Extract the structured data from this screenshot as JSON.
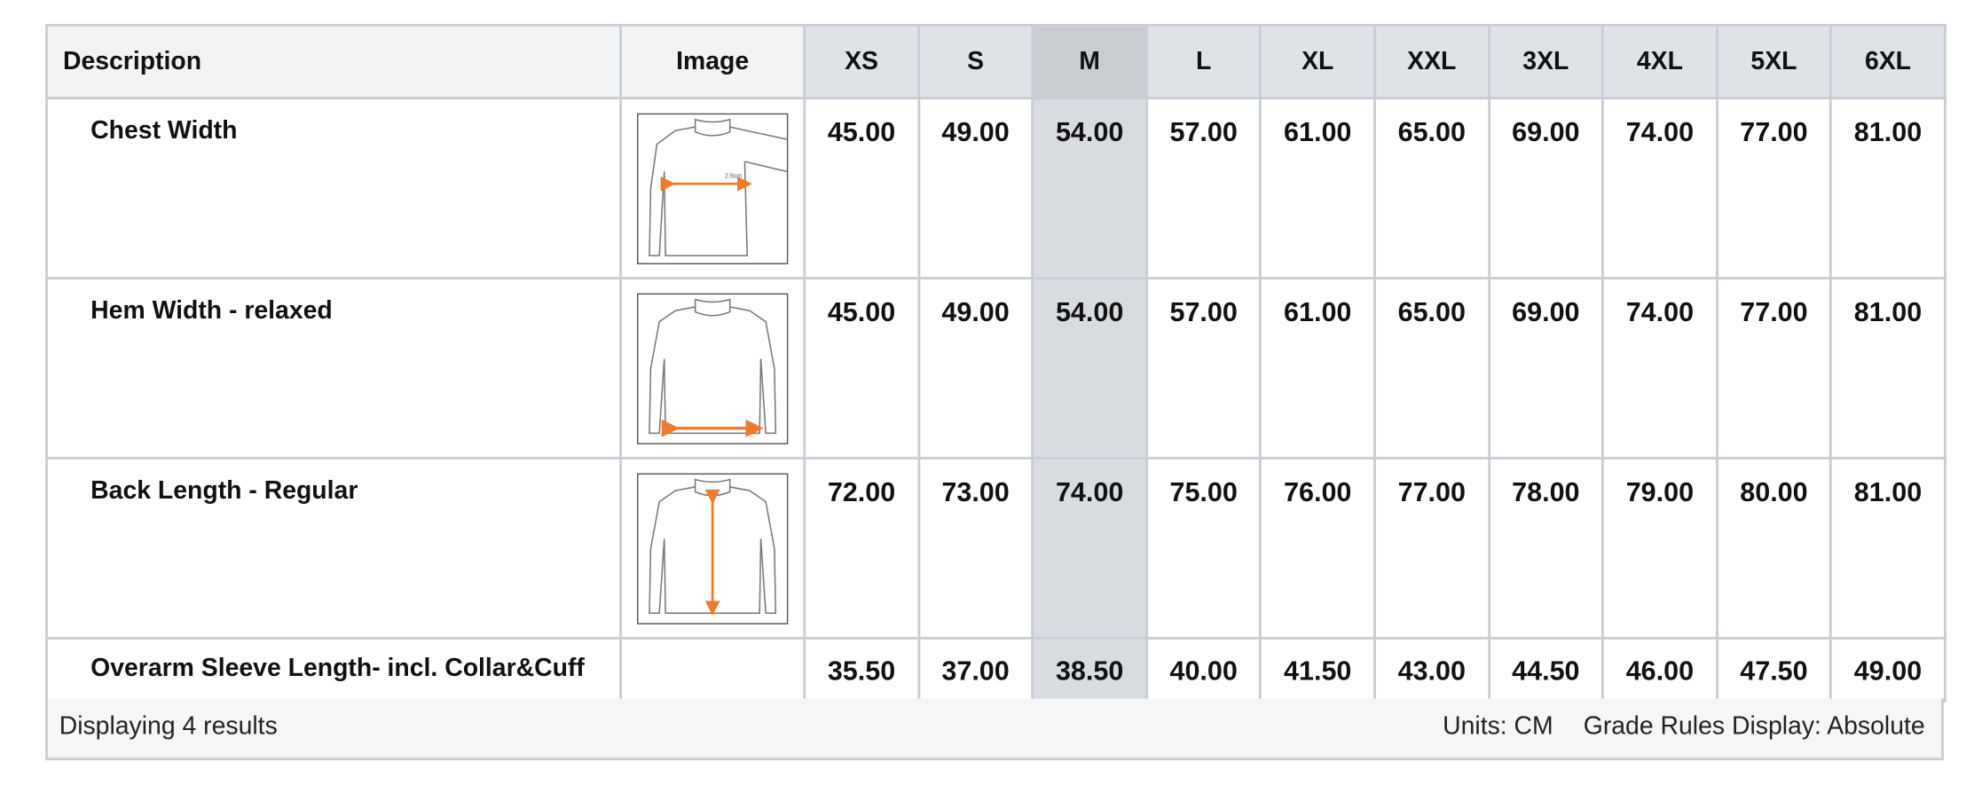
{
  "table": {
    "headers": {
      "description": "Description",
      "image": "Image",
      "sizes": [
        "XS",
        "S",
        "M",
        "L",
        "XL",
        "XXL",
        "3XL",
        "4XL",
        "5XL",
        "6XL"
      ],
      "highlighted_size": "M"
    },
    "rows": [
      {
        "description": "Chest Width",
        "image": "chest-width-diagram",
        "image_label": "2.5cm",
        "values": [
          "45.00",
          "49.00",
          "54.00",
          "57.00",
          "61.00",
          "65.00",
          "69.00",
          "74.00",
          "77.00",
          "81.00"
        ]
      },
      {
        "description": "Hem Width - relaxed",
        "image": "hem-width-diagram",
        "values": [
          "45.00",
          "49.00",
          "54.00",
          "57.00",
          "61.00",
          "65.00",
          "69.00",
          "74.00",
          "77.00",
          "81.00"
        ]
      },
      {
        "description": "Back Length - Regular",
        "image": "back-length-diagram",
        "values": [
          "72.00",
          "73.00",
          "74.00",
          "75.00",
          "76.00",
          "77.00",
          "78.00",
          "79.00",
          "80.00",
          "81.00"
        ]
      },
      {
        "description": "Overarm Sleeve Length- incl. Collar&Cuff",
        "image": null,
        "values": [
          "35.50",
          "37.00",
          "38.50",
          "40.00",
          "41.50",
          "43.00",
          "44.50",
          "46.00",
          "47.50",
          "49.00"
        ]
      }
    ]
  },
  "footer": {
    "results_text": "Displaying 4 results",
    "units_text": "Units: CM",
    "grade_rules_text": "Grade Rules Display: Absolute"
  },
  "colors": {
    "header_bg": "#dfe2e6",
    "highlight_column_bg": "#d8dbdf",
    "border": "#c9cdd3",
    "measure_arrow": "#ee7a2b"
  }
}
